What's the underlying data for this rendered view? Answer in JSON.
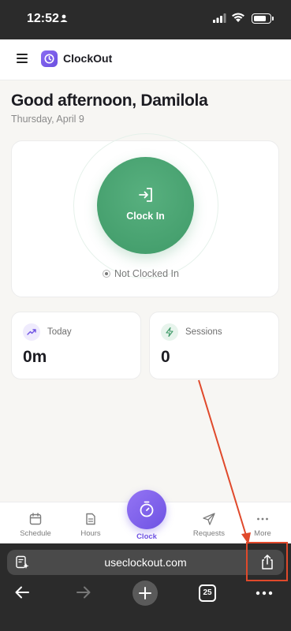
{
  "status_bar": {
    "time": "12:52"
  },
  "header": {
    "app_name": "ClockOut",
    "menu_icon": "hamburger-menu-icon",
    "logo_icon": "clock-logo-icon"
  },
  "greeting": {
    "title": "Good afternoon, Damilola",
    "date": "Thursday, April 9"
  },
  "clock_card": {
    "button_label": "Clock In",
    "button_icon": "sign-in-icon",
    "status": "Not Clocked In"
  },
  "stats": [
    {
      "label": "Today",
      "value": "0m",
      "icon": "trending-up-icon",
      "accent": "#6e52e3"
    },
    {
      "label": "Sessions",
      "value": "0",
      "icon": "lightning-icon",
      "accent": "#3f9a68"
    }
  ],
  "tabbar": {
    "items": [
      {
        "label": "Schedule",
        "icon": "calendar-icon"
      },
      {
        "label": "Hours",
        "icon": "document-icon"
      },
      {
        "label": "Clock",
        "icon": "stopwatch-icon"
      },
      {
        "label": "Requests",
        "icon": "send-icon"
      },
      {
        "label": "More",
        "icon": "more-dots-icon"
      }
    ],
    "active": "Clock"
  },
  "browser": {
    "url": "useclockout.com",
    "tab_count": "25"
  },
  "colors": {
    "primary": "#6e52e3",
    "success": "#3f9a68",
    "annotation": "#e0492b"
  }
}
